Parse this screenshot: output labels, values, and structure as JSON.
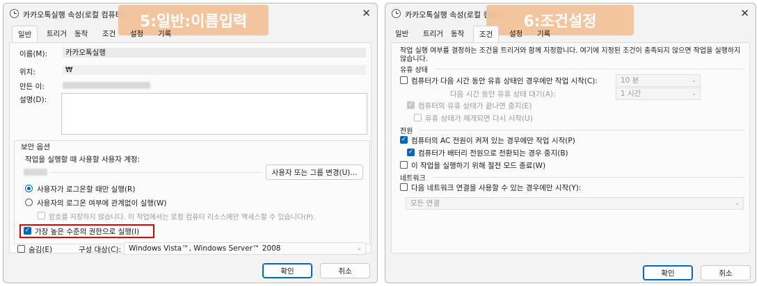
{
  "left": {
    "title": "카카오톡실행 속성(로컬 컴퓨터)",
    "banner": "5:일반:이름입력",
    "tabs": [
      "일반",
      "트리거",
      "동작",
      "조건",
      "설정",
      "기록"
    ],
    "name_label": "이름(M):",
    "name_value": "카카오톡실행",
    "location_label": "위치:",
    "location_value": "₩",
    "author_label": "만든 이:",
    "desc_label": "설명(D):",
    "security_label": "보안 옵션",
    "run_as_label": "작업을 실행할 때 사용할 사용자 계정:",
    "change_user_btn": "사용자 또는 그룹 변경(U)...",
    "radio_logged_on": "사용자가 로그온할 때만 실행(R)",
    "radio_any": "사용자의 로그온 여부에 관계없이 실행(W)",
    "no_store_pw": "암호를 저장하지 않습니다. 이 작업에서는 로컬 컴퓨터 리소스에만 액세스할 수 있습니다(P).",
    "highest_priv": "가장 높은 수준의 권한으로 실행(I)",
    "hidden": "숨김(E)",
    "configure_label": "구성 대상(C):",
    "configure_value": "Windows Vista™, Windows Server™ 2008",
    "ok": "확인",
    "cancel": "취소",
    "check_glyph": "✓",
    "arrow_glyph": "⌄",
    "close_glyph": "✕"
  },
  "right": {
    "title": "카카오톡실행 속성(로컬 컴퓨터)",
    "banner": "6:조건설정",
    "tabs": [
      "일반",
      "트리거",
      "동작",
      "조건",
      "설정",
      "기록"
    ],
    "intro": "작업 실행 여부를 결정하는 조건을 트리거와 함께 지정합니다. 여기에 지정된 조건이 충족되지 않으면 작업을 실행하지 않습니다.",
    "idle_header": "유휴 상태",
    "idle_start": "컴퓨터가 다음 시간 동안 유휴 상태인 경우에만 작업 시작(C):",
    "idle_duration": "10 분",
    "idle_wait_label": "다음 시간 동안 유휴 상태 대기(A):",
    "idle_wait": "1 시간",
    "idle_stop": "컴퓨터의 유휴 상태가 끝나면 중지(E)",
    "idle_restart": "유휴 상태가 재개되면 다시 시작(U)",
    "power_header": "전원",
    "power_ac": "컴퓨터의 AC 전원이 켜져 있는 경우에만 작업 시작(P)",
    "power_battery": "컴퓨터가 배터리 전원으로 전환되는 경우 중지(B)",
    "power_wake": "이 작업을 실행하기 위해 절전 모드 종료(W)",
    "net_header": "네트워크",
    "net_start": "다음 네트워크 연결을 사용할 수 있는 경우에만 시작(Y):",
    "net_value": "모든 연결",
    "ok": "확인",
    "cancel": "취소",
    "check_glyph": "✓",
    "arrow_glyph": "⌄",
    "close_glyph": "✕"
  },
  "colors": {
    "accent": "#0067c0",
    "banner": "#f3c39a",
    "highlight": "#e00000"
  }
}
